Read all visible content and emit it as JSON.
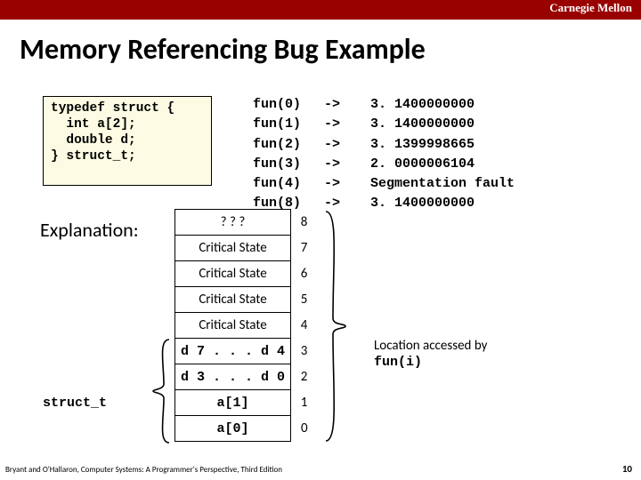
{
  "header": {
    "org": "Carnegie Mellon"
  },
  "title": "Memory Referencing Bug Example",
  "codebox": "typedef struct {\n  int a[2];\n  double d;\n} struct_t;",
  "output": {
    "rows": [
      {
        "call": "fun(0)",
        "arrow": "->",
        "result": "3. 1400000000"
      },
      {
        "call": "fun(1)",
        "arrow": "->",
        "result": "3. 1400000000"
      },
      {
        "call": "fun(2)",
        "arrow": "->",
        "result": "3. 1399998665"
      },
      {
        "call": "fun(3)",
        "arrow": "->",
        "result": "2. 0000006104"
      },
      {
        "call": "fun(4)",
        "arrow": "->",
        "result": "Segmentation fault"
      },
      {
        "call": "fun(8)",
        "arrow": "->",
        "result": "3. 1400000000"
      }
    ]
  },
  "explain_label": "Explanation:",
  "memtable": {
    "rows": [
      {
        "txt": "? ? ?",
        "idx": "8",
        "mono": false
      },
      {
        "txt": "Critical State",
        "idx": "7",
        "mono": false
      },
      {
        "txt": "Critical State",
        "idx": "6",
        "mono": false
      },
      {
        "txt": "Critical State",
        "idx": "5",
        "mono": false
      },
      {
        "txt": "Critical State",
        "idx": "4",
        "mono": false
      },
      {
        "txt": "d 7 . . . d 4",
        "idx": "3",
        "mono": true
      },
      {
        "txt": "d 3 . . . d 0",
        "idx": "2",
        "mono": true
      },
      {
        "txt": "a[1]",
        "idx": "1",
        "mono": true
      },
      {
        "txt": "a[0]",
        "idx": "0",
        "mono": true
      }
    ]
  },
  "struct_label": "struct_t",
  "location_text": {
    "l1": "Location accessed by",
    "l2": "fun(i)"
  },
  "footer": {
    "left": "Bryant and O'Hallaron, Computer Systems: A Programmer's Perspective, Third Edition",
    "right": "10"
  }
}
